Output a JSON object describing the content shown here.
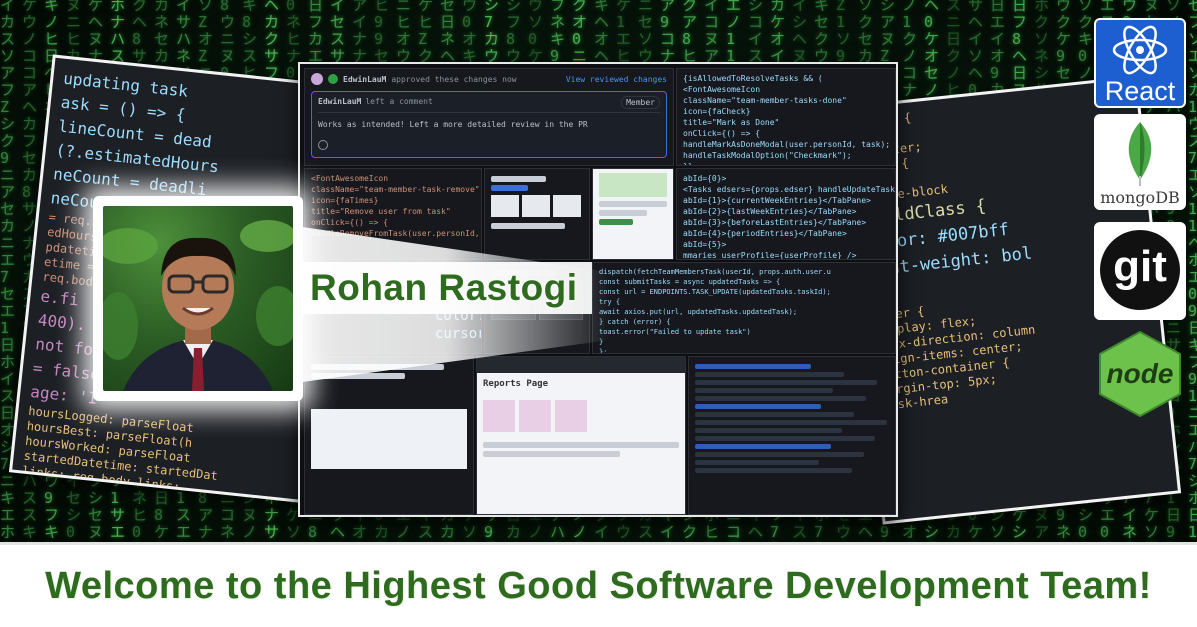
{
  "profile": {
    "name": "Rohan Rastogi"
  },
  "banner": {
    "title": "Welcome to the Highest Good Software Development Team!"
  },
  "logos": {
    "react": "React",
    "mongodb": "mongoDB",
    "git": "git",
    "node": "node"
  },
  "left_code": {
    "lines": [
      "updating task",
      "ask = () => {",
      "lineCount = dead",
      "(?.estimatedHours",
      "neCount = deadli",
      "neCount(newDeadli",
      "e.fi",
      "400).",
      "not fo",
      "= false",
      "age: 'I",
      "ask = updating task",
      "lineCount = de",
      "?.estimatedHou",
      "neCount(newDeadl"
    ],
    "small_lines": [
      "= req.body.hoursWorked",
      "edHours = req.body.est",
      "pdatetime = req.body.st",
      "etime = req.body.dueDat",
      "req.body.category;",
      "hoursLogged: parseFloat",
      "hoursBest: parseFloat(h",
      "hoursWorked: parseFloat",
      "startedDatetime: startedDat",
      "links: req.body.links;",
      "category: req.body.category"
    ]
  },
  "right_code": {
    "lines": [
      "rapper {",
      "ox;",
      ": center;",
      "-text {",
      "x;",
      "inline-block",
      ".boldClass {",
      "color: #007bff",
      "font-weight: bol",
      "}",
      "ainer {",
      "display: flex;",
      "flex-direction: column",
      "align-items: center;",
      "button-container {",
      "margin-top: 5px;",
      "task-hrea"
    ]
  },
  "collage": {
    "top_comment": {
      "author": "EdwinLauM",
      "action": "approved these changes now",
      "view_link": "View reviewed changes",
      "inner_author": "EdwinLauM",
      "inner_action": "left a comment",
      "inner_badge": "Member",
      "body": "Works as intended! Left a more detailed review in the PR"
    },
    "jsx_top": [
      "{isAllowedToResolveTasks && (",
      "  <FontAwesomeIcon",
      "    className=\"team-member-tasks-done\"",
      "    icon={faCheck}",
      "    title=\"Mark as Done\"",
      "    onClick={() => {",
      "      handleMarkAsDoneModal(user.personId, task);",
      "      handleTaskModalOption(\"Checkmark\");",
      "    }}",
      "  />"
    ],
    "jsx_mid": [
      "<FontAwesomeIcon",
      "  className=\"team-member-task-remove\"",
      "  icon={faTimes}",
      "  title=\"Remove user from task\"",
      "  onClick={() => {",
      "    handleRemoveFromTask(user.personId, task)"
    ],
    "tabs_code": [
      "abId={0}>",
      "<Tasks edsers={props.edser} handleUpdateTask handleUpdateTask",
      "abId={1}>{currentWeekEntries}</TabPane>",
      "abId={2}>{lastWeekEntries}</TabPane>",
      "abId={3}>{beforeLastEntries}</TabPane>",
      "abId={4}>{periodEntries}</TabPane>",
      "abId={5}>",
      "mmaries userProfile={userProfile} />"
    ],
    "css_mini": [
      "color: white;",
      "cursor: pointer;"
    ],
    "async_code": [
      "dispatch(fetchTeamMembersTask(userId, props.auth.user.u",
      "const submitTasks = async updatedTasks => {",
      "  const url = ENDPOINTS.TASK_UPDATE(updatedTasks.taskId);",
      "  try {",
      "    await axios.put(url, updatedTasks.updatedTask);",
      "  } catch (error) {",
      "    toast.error(\"Failed to update task\")",
      "  }",
      "};",
      "const handleOpenTaskNotificationModal = (userId, task, taskNo"
    ],
    "review_title": "Reports Page"
  }
}
